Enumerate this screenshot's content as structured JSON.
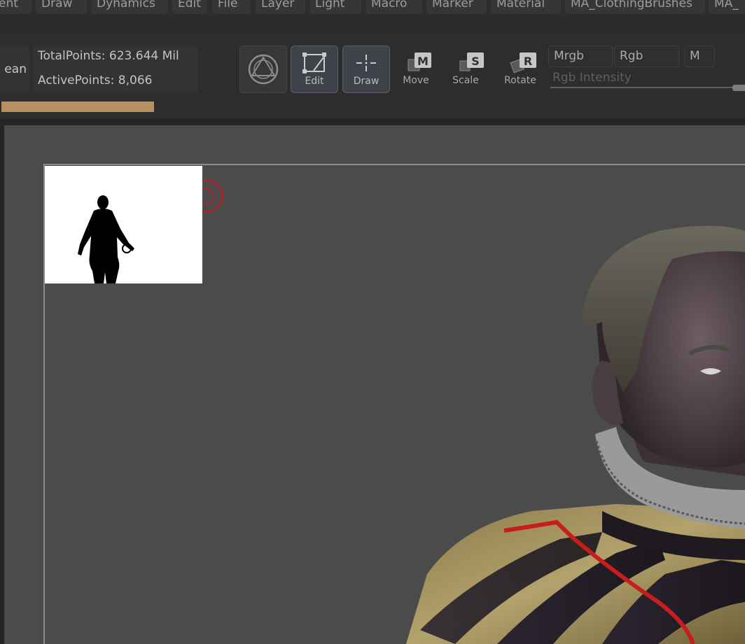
{
  "menu": {
    "items": [
      "ent",
      "Draw",
      "Dynamics",
      "Edit",
      "File",
      "Layer",
      "Light",
      "Macro",
      "Marker",
      "Material",
      "MA_ClothingBrushes",
      "MA_"
    ]
  },
  "stats": {
    "clean_label": "ean",
    "total_points": "TotalPoints: 623.644 Mil",
    "active_points": "ActivePoints: 8,066",
    "progress_fraction": 0.21
  },
  "tools": {
    "edit": "Edit",
    "draw": "Draw",
    "move": "Move",
    "scale": "Scale",
    "rotate": "Rotate",
    "move_key": "M",
    "scale_key": "S",
    "rotate_key": "R"
  },
  "color": {
    "mrgb": "Mrgb",
    "rgb": "Rgb",
    "m": "M",
    "intensity_label": "Rgb Intensity"
  },
  "colors": {
    "accent_progress": "#b88f5f",
    "canvas_bg": "#4b4b4c",
    "focal_red": "#a3262b"
  }
}
